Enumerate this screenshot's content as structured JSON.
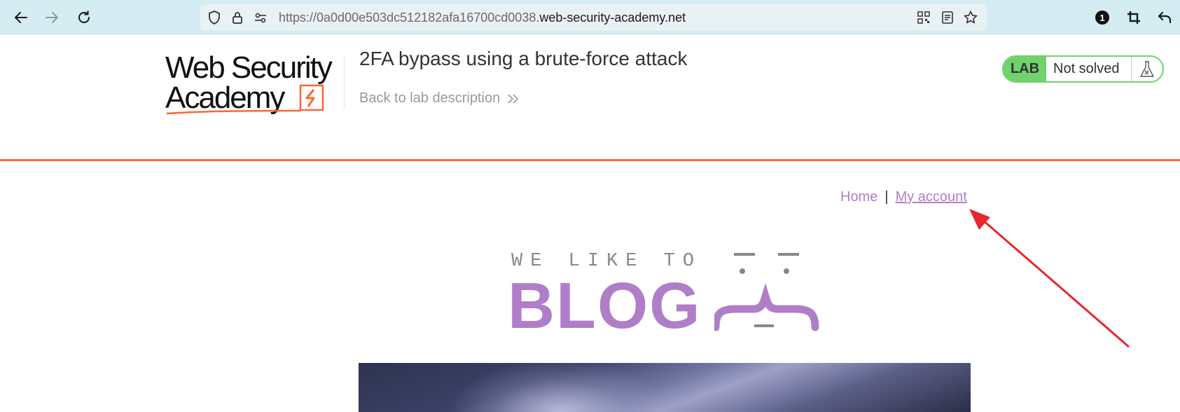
{
  "browser": {
    "url_host_prefix": "https://0a0d00e503dc512182afa16700cd0038.",
    "url_domain": "web-security-academy.net",
    "notification_count": "1",
    "icons": [
      "back-arrow-icon",
      "forward-arrow-icon",
      "reload-icon",
      "shield-icon",
      "lock-icon",
      "site-settings-icon",
      "qr-code-icon",
      "reader-view-icon",
      "bookmark-star-icon",
      "notification-badge-icon",
      "crop-icon",
      "undo-icon"
    ]
  },
  "header": {
    "logo_line1": "Web Security",
    "logo_line2": "Academy",
    "lab_title": "2FA bypass using a brute-force attack",
    "back_link": "Back to lab description",
    "lab_badge": "LAB",
    "lab_status": "Not solved",
    "colors": {
      "accent": "#ff6633",
      "lab_green": "#70d16d"
    }
  },
  "site_nav": {
    "home": "Home",
    "separator": "|",
    "my_account": "My account",
    "link_color": "#b07ec8"
  },
  "blog_logo": {
    "tagline": "WE LIKE TO",
    "word": "BLOG"
  },
  "annotation": {
    "color": "#e8262c",
    "points_to": "My account"
  }
}
